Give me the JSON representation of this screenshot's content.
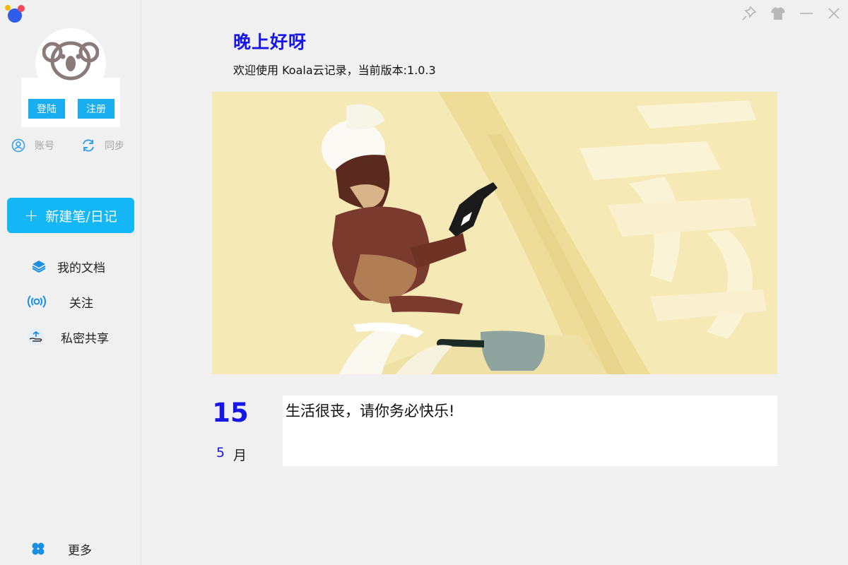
{
  "user": {
    "login_label": "登陆",
    "register_label": "注册",
    "account_label": "账号",
    "sync_label": "同步"
  },
  "sidebar": {
    "new_note_label": "新建笔/日记",
    "items": [
      {
        "label": "我的文档",
        "icon": "layers-icon"
      },
      {
        "label": "关注",
        "icon": "broadcast-icon"
      },
      {
        "label": "私密共享",
        "icon": "share-hand-icon"
      }
    ],
    "more_label": "更多"
  },
  "main": {
    "greeting": "晚上好呀",
    "welcome": "欢迎使用 Koala云记录，当前版本:1.0.3",
    "date": {
      "day": "15",
      "month_num": "5",
      "month_label": "月"
    },
    "quote": "生活很丧，请你务必快乐!"
  },
  "colors": {
    "accent": "#14b7f5",
    "greeting": "#1616e6",
    "banner_bg": "#f5e9b5"
  }
}
